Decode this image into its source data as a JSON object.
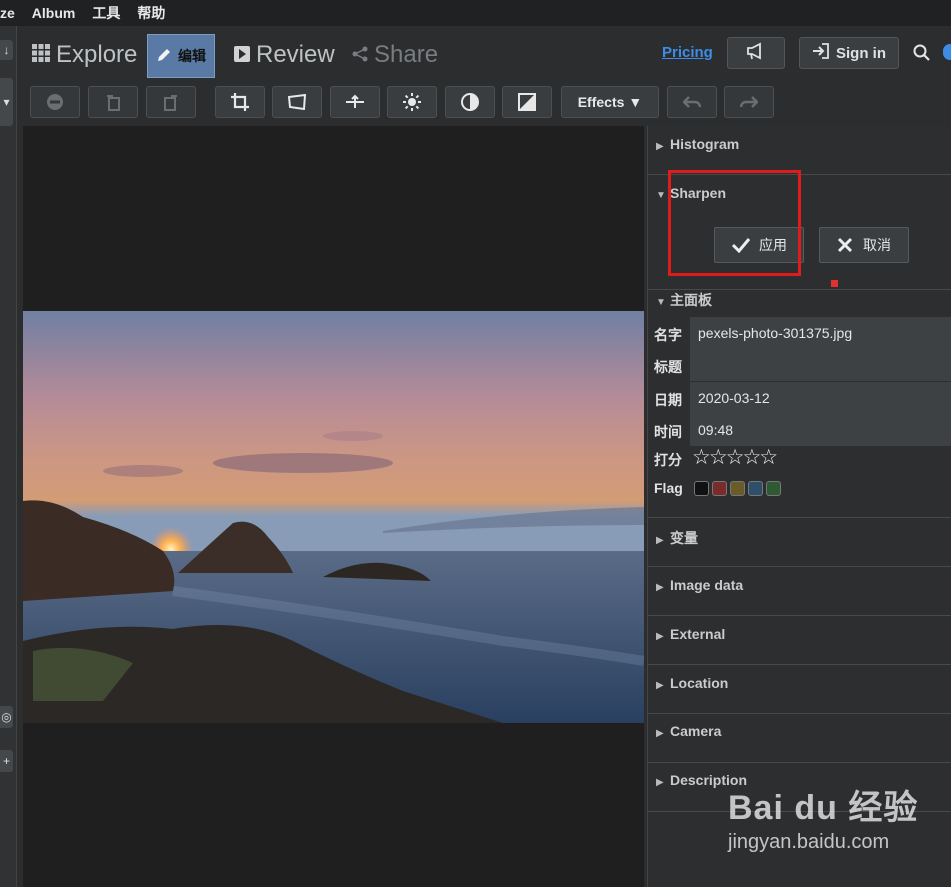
{
  "menu": {
    "items": [
      "ze",
      "Album",
      "工具",
      "帮助"
    ]
  },
  "nav": {
    "explore": "Explore",
    "edit": "编辑",
    "review": "Review",
    "share": "Share",
    "pricing": "Pricing",
    "signin": "Sign in"
  },
  "toolbar": {
    "effects": "Effects"
  },
  "panel": {
    "histogram": "Histogram",
    "sharpen": "Sharpen",
    "apply": "应用",
    "cancel": "取消",
    "main": "主面板",
    "fields": {
      "name_label": "名字",
      "name_value": "pexels-photo-301375.jpg",
      "title_label": "标题",
      "title_value": "",
      "date_label": "日期",
      "date_value": "2020-03-12",
      "time_label": "时间",
      "time_value": "09:48",
      "rating_label": "打分",
      "rating_stars": "☆☆☆☆☆",
      "flag_label": "Flag"
    },
    "sections": [
      "变量",
      "Image data",
      "External",
      "Location",
      "Camera",
      "Description"
    ]
  },
  "flag_colors": [
    "#111111",
    "#7a2b2b",
    "#6b5a2a",
    "#2d4f6b",
    "#2d5a33"
  ],
  "colors": {
    "accent": "#3d8de6",
    "active_tab": "#5a7aa6",
    "highlight_box": "#e01b1b"
  },
  "watermark": {
    "brand": "Bai du 经验",
    "url": "jingyan.baidu.com"
  }
}
